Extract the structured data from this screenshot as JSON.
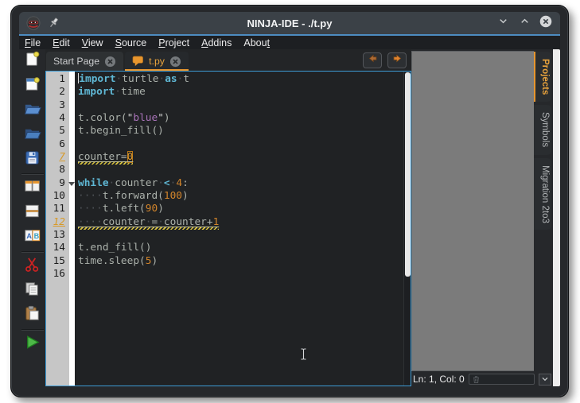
{
  "window": {
    "title": "NINJA-IDE - ./t.py",
    "titlebar_icons": [
      "ninja-logo",
      "pin"
    ],
    "controls": [
      {
        "icon": "minimize"
      },
      {
        "icon": "maximize"
      },
      {
        "icon": "close"
      }
    ]
  },
  "menubar": {
    "items": [
      {
        "label": "File",
        "mnemonic_index": 0
      },
      {
        "label": "Edit",
        "mnemonic_index": 0
      },
      {
        "label": "View",
        "mnemonic_index": 0
      },
      {
        "label": "Source",
        "mnemonic_index": 0
      },
      {
        "label": "Project",
        "mnemonic_index": 0
      },
      {
        "label": "Addins",
        "mnemonic_index": 0
      },
      {
        "label": "About",
        "mnemonic_index": 4
      }
    ]
  },
  "tabbar": {
    "tabs": [
      {
        "label": "Start Page",
        "icon": null,
        "close_icon": "close",
        "active": false
      },
      {
        "label": "t.py",
        "icon": "chat-bubble",
        "close_icon": "close",
        "active": true
      }
    ],
    "nav_buttons": [
      {
        "icon": "back-arrow"
      },
      {
        "icon": "forward-arrow"
      }
    ]
  },
  "toolbar": {
    "items": [
      "new-file",
      "new-project",
      "open-file",
      "open-project",
      "save",
      "separator",
      "split-horizontal",
      "split-vertical",
      "follow-mode",
      "separator",
      "cut",
      "copy",
      "paste",
      "separator",
      "run"
    ]
  },
  "editor": {
    "warning_lines": [
      7,
      12
    ],
    "fold_markers": [
      9
    ],
    "lines": [
      {
        "n": 1,
        "segs": [
          [
            "caret",
            ""
          ],
          [
            "kw",
            "import"
          ],
          [
            "ws",
            " "
          ],
          [
            "txt",
            "turtle"
          ],
          [
            "ws",
            " "
          ],
          [
            "kw",
            "as"
          ],
          [
            "ws",
            " "
          ],
          [
            "txt",
            "t"
          ]
        ]
      },
      {
        "n": 2,
        "segs": [
          [
            "kw",
            "import"
          ],
          [
            "ws",
            " "
          ],
          [
            "txt",
            "time"
          ]
        ]
      },
      {
        "n": 3,
        "segs": []
      },
      {
        "n": 4,
        "segs": [
          [
            "txt",
            "t.color("
          ],
          [
            "quote",
            "\""
          ],
          [
            "str",
            "blue"
          ],
          [
            "quote",
            "\""
          ],
          [
            "txt",
            ")"
          ]
        ]
      },
      {
        "n": 5,
        "segs": [
          [
            "txt",
            "t.begin_fill()"
          ]
        ]
      },
      {
        "n": 6,
        "segs": []
      },
      {
        "n": 7,
        "warn": true,
        "segs": [
          [
            "txt",
            "counter="
          ],
          [
            "numbox",
            "0"
          ]
        ]
      },
      {
        "n": 8,
        "segs": []
      },
      {
        "n": 9,
        "fold": true,
        "segs": [
          [
            "kw",
            "while"
          ],
          [
            "ws",
            " "
          ],
          [
            "txt",
            "counter"
          ],
          [
            "ws",
            " "
          ],
          [
            "kw",
            "<"
          ],
          [
            "ws",
            " "
          ],
          [
            "num",
            "4"
          ],
          [
            "txt",
            ":"
          ]
        ]
      },
      {
        "n": 10,
        "segs": [
          [
            "ws",
            "    "
          ],
          [
            "txt",
            "t.forward("
          ],
          [
            "num",
            "100"
          ],
          [
            "txt",
            ")"
          ]
        ]
      },
      {
        "n": 11,
        "segs": [
          [
            "ws",
            "    "
          ],
          [
            "txt",
            "t.left("
          ],
          [
            "num",
            "90"
          ],
          [
            "txt",
            ")"
          ]
        ]
      },
      {
        "n": 12,
        "warn": true,
        "segs": [
          [
            "ws",
            "    "
          ],
          [
            "txt",
            "counter"
          ],
          [
            "ws",
            " "
          ],
          [
            "txt",
            "="
          ],
          [
            "ws",
            " "
          ],
          [
            "txt",
            "counter+"
          ],
          [
            "num",
            "1"
          ]
        ]
      },
      {
        "n": 13,
        "segs": []
      },
      {
        "n": 14,
        "segs": [
          [
            "txt",
            "t.end_fill()"
          ]
        ]
      },
      {
        "n": 15,
        "segs": [
          [
            "txt",
            "time.sleep("
          ],
          [
            "num",
            "5"
          ],
          [
            "txt",
            ")"
          ]
        ]
      },
      {
        "n": 16,
        "segs": []
      }
    ]
  },
  "right_panel": {
    "tabs": [
      {
        "label": "Projects",
        "active": true
      },
      {
        "label": "Symbols",
        "active": false
      },
      {
        "label": "Migration 2to3",
        "active": false
      }
    ]
  },
  "statusbar": {
    "position": "Ln: 1, Col: 0",
    "field_icon": "trash",
    "dropdown_icon": "chevron-down"
  },
  "pointer": {
    "style": "text-ibeam"
  },
  "colors": {
    "titlebar": "#3b4147",
    "accent_line": "#4d8cc0",
    "menubar_bg": "#1d1f22",
    "content_bg": "#26282b",
    "tab_active_text": "#e8a23c",
    "tab_accent": "#e8962e",
    "editor_bg": "#202224",
    "gutter_bg": "#c6c6c6",
    "editor_border": "#3d9bd5",
    "keyword": "#5fb7d4",
    "plain": "#abb1ab",
    "number": "#d1842b",
    "string": "#a873b8",
    "warning_underline": "#d8c23c",
    "panel_bg": "#7b7b7b"
  }
}
